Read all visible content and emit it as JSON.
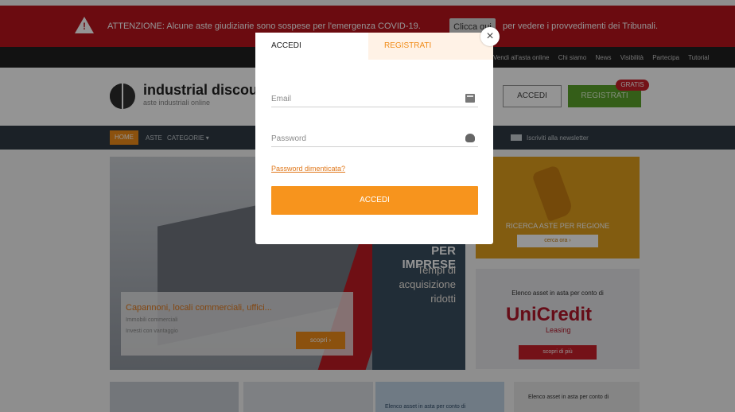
{
  "alert": {
    "message": "ATTENZIONE: Alcune aste giudiziarie sono sospese per l'emergenza COVID-19.",
    "click_label": "Clicca qui",
    "message_suffix": "per vedere i provvedimenti dei Tribunali."
  },
  "topbar": {
    "items": [
      "Vendi all'asta online",
      "Chi siamo",
      "News",
      "Visibilità",
      "Partecipa",
      "Tutorial"
    ]
  },
  "header": {
    "logo_text": "industrial discount",
    "logo_sub": "aste industriali online",
    "accedi_label": "ACCEDI",
    "registrati_label": "REGISTRATI",
    "gratis_badge": "GRATIS"
  },
  "nav": {
    "home": "HOME",
    "aste": "ASTE",
    "categorie": "CATEGORIE ▾",
    "newsletter": "Iscriviti alla newsletter"
  },
  "hero": {
    "slogan_title": "PER IMPRESE",
    "slogan_sub": "Tempi di acquisizione ridotti",
    "card_title": "Capannoni, locali commerciali, uffici...",
    "card_line1": "Immobili commerciali",
    "card_line2": "Investi con vantaggio",
    "card_button": "scopri ›"
  },
  "promo_map": {
    "caption": "RICERCA ASTE PER REGIONE",
    "button": "cerca ora ›"
  },
  "promo_uc": {
    "caption": "Elenco asset in asta per conto di",
    "brand": "UniCredit",
    "brand_sub": "Leasing",
    "button": "scopri di più"
  },
  "row2": {
    "c_text": "Elenco asset in asta per conto di",
    "d_text": "Elenco asset in asta per conto di"
  },
  "modal": {
    "tab_login": "ACCEDI",
    "tab_register": "REGISTRATI",
    "email_placeholder": "Email",
    "password_placeholder": "Password",
    "forgot_link": "Password dimenticata?",
    "submit_label": "ACCEDI",
    "close_symbol": "×"
  }
}
